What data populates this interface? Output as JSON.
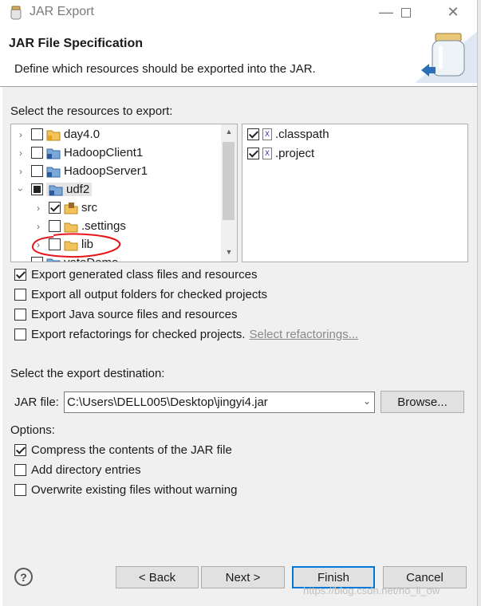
{
  "window": {
    "title": "JAR Export"
  },
  "header": {
    "title": "JAR File Specification",
    "description": "Define which resources should be exported into the JAR."
  },
  "resources": {
    "label": "Select the resources to export:",
    "tree": [
      {
        "label": "day4.0",
        "checked": "unchecked",
        "expanded": false
      },
      {
        "label": "HadoopClient1",
        "checked": "unchecked",
        "expanded": false
      },
      {
        "label": "HadoopServer1",
        "checked": "unchecked",
        "expanded": false
      },
      {
        "label": "udf2",
        "checked": "partial",
        "expanded": true
      },
      {
        "label": "src",
        "checked": "checked"
      },
      {
        "label": ".settings",
        "checked": "unchecked"
      },
      {
        "label": "lib",
        "checked": "unchecked"
      },
      {
        "label": "voteDemo",
        "checked": "unchecked"
      }
    ],
    "files": [
      {
        "label": ".classpath",
        "checked": true
      },
      {
        "label": ".project",
        "checked": true
      }
    ]
  },
  "export_options": [
    {
      "label": "Export generated class files and resources",
      "checked": true
    },
    {
      "label": "Export all output folders for checked projects",
      "checked": false
    },
    {
      "label": "Export Java source files and resources",
      "checked": false
    },
    {
      "label": "Export refactorings for checked projects.",
      "checked": false
    }
  ],
  "select_refactorings_link": "Select refactorings...",
  "destination": {
    "label": "Select the export destination:",
    "jar_label": "JAR file:",
    "jar_value": "C:\\Users\\DELL005\\Desktop\\jingyi4.jar",
    "browse": "Browse..."
  },
  "options": {
    "label": "Options:",
    "items": [
      {
        "label": "Compress the contents of the JAR file",
        "checked": true
      },
      {
        "label": "Add directory entries",
        "checked": false
      },
      {
        "label": "Overwrite existing files without warning",
        "checked": false
      }
    ]
  },
  "buttons": {
    "help": "?",
    "back": "< Back",
    "next": "Next >",
    "finish": "Finish",
    "cancel": "Cancel"
  },
  "watermark": "https://blog.csdn.net/no_ll_ow",
  "colors": {
    "annotation": "#e8141c",
    "accent": "#0078d7",
    "dialog_bg": "#f0f0f0"
  }
}
